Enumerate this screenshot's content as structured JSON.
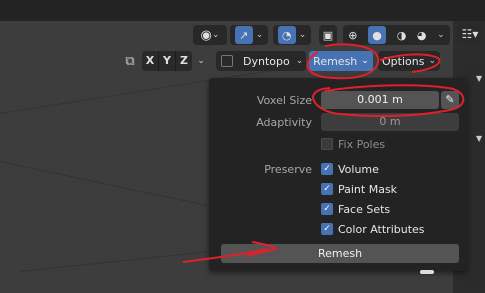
{
  "header": {
    "symmetry": {
      "x": "X",
      "y": "Y",
      "z": "Z"
    },
    "dyntopo_label": "Dyntopo",
    "remesh_label": "Remesh",
    "options_label": "Options"
  },
  "popup": {
    "voxel_size_label": "Voxel Size",
    "voxel_size_value": "0.001 m",
    "adaptivity_label": "Adaptivity",
    "adaptivity_value": "0 m",
    "fix_poles_label": "Fix Poles",
    "preserve_label": "Preserve",
    "preserve_items": [
      {
        "label": "Volume",
        "checked": true
      },
      {
        "label": "Paint Mask",
        "checked": true
      },
      {
        "label": "Face Sets",
        "checked": true
      },
      {
        "label": "Color Attributes",
        "checked": true
      }
    ],
    "remesh_button": "Remesh"
  },
  "colors": {
    "accent": "#4772b3",
    "annotation": "#e0202a"
  }
}
